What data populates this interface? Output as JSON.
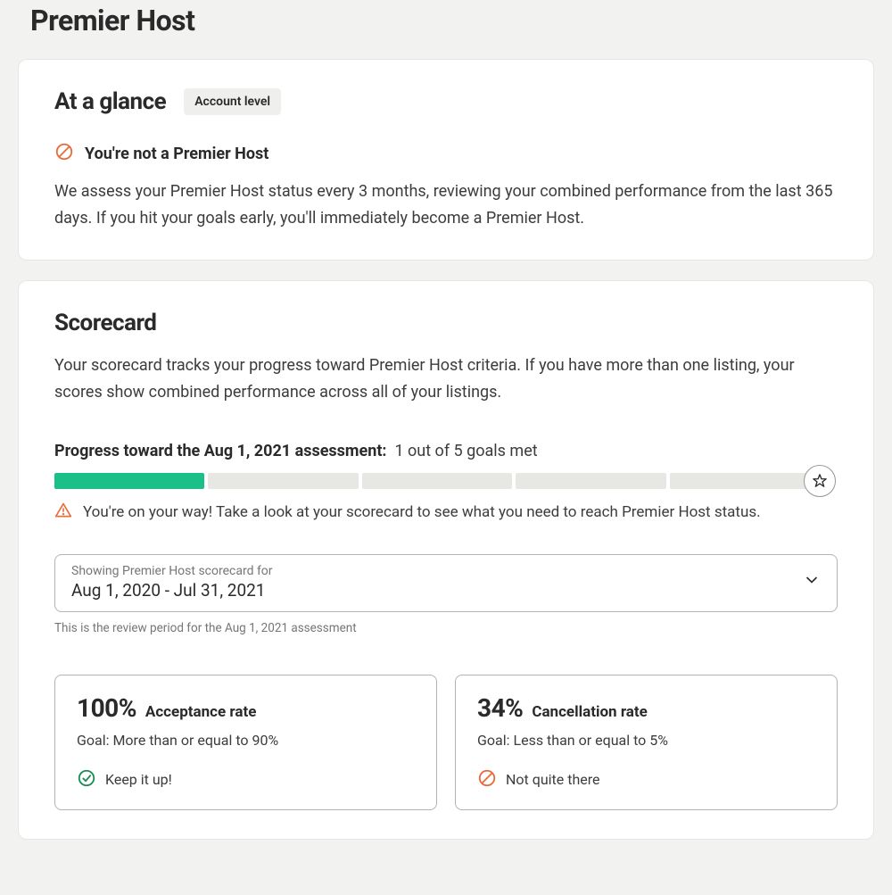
{
  "page_title": "Premier Host",
  "at_a_glance": {
    "heading": "At a glance",
    "badge": "Account level",
    "status_text": "You're not a Premier Host",
    "description": "We assess your Premier Host status every 3 months, reviewing your combined performance from the last 365 days. If you hit your goals early, you'll immediately become a Premier Host."
  },
  "scorecard": {
    "heading": "Scorecard",
    "description": "Your scorecard tracks your progress toward Premier Host criteria. If you have more than one listing, your scores show combined performance across all of your listings.",
    "progress_label_bold": "Progress toward the Aug 1, 2021 assessment:",
    "progress_label_value": "1 out of 5 goals met",
    "progress_segments_total": 5,
    "progress_segments_filled": 1,
    "progress_message": "You're on your way! Take a look at your scorecard to see what you need to reach Premier Host status.",
    "selector": {
      "label": "Showing Premier Host scorecard for",
      "value": "Aug 1, 2020 - Jul 31, 2021"
    },
    "helper_text": "This is the review period for the Aug 1, 2021 assessment",
    "metrics": {
      "acceptance": {
        "value": "100%",
        "label": "Acceptance rate",
        "goal": "Goal: More than or equal to 90%",
        "status_text": "Keep it up!",
        "status_kind": "success"
      },
      "cancellation": {
        "value": "34%",
        "label": "Cancellation rate",
        "goal": "Goal: Less than or equal to 5%",
        "status_text": "Not quite there",
        "status_kind": "blocked"
      }
    }
  }
}
